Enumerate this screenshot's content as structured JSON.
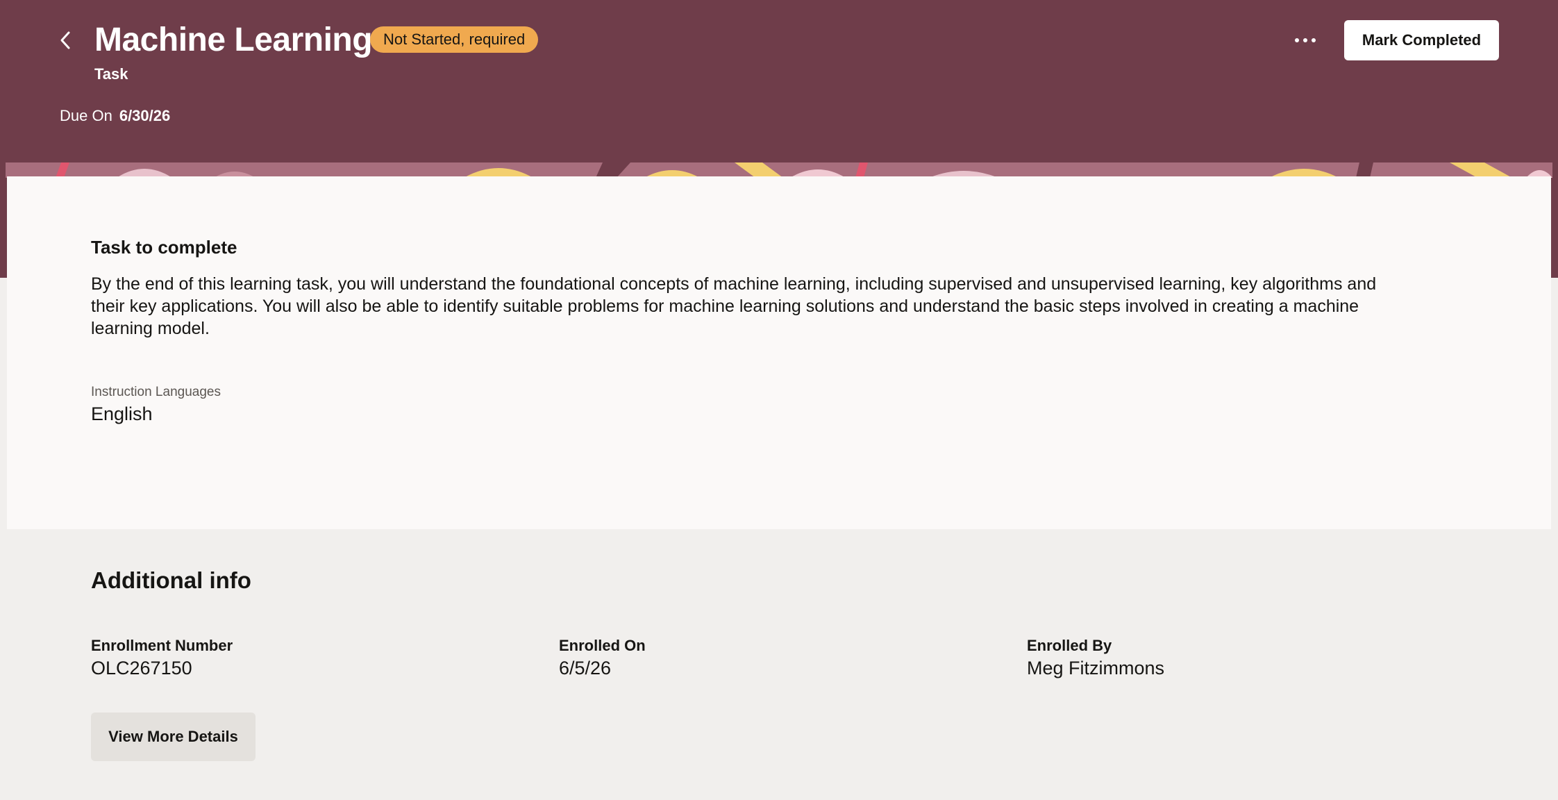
{
  "header": {
    "title": "Machine Learning",
    "status": "Not Started, required",
    "subtitle": "Task",
    "due_label": "Due On",
    "due_value": "6/30/26",
    "primary_action": "Mark Completed",
    "more_icon": "more-horizontal-icon",
    "back_icon": "chevron-left-icon"
  },
  "task": {
    "heading": "Task to complete",
    "description": "By the end of this learning task, you will understand the foundational concepts of machine learning, including supervised and unsupervised learning, key algorithms and their key applications. You will also be able to identify suitable problems for machine learning solutions and understand the basic steps involved in creating a machine learning model.",
    "languages_label": "Instruction Languages",
    "languages_value": "English"
  },
  "additional_info": {
    "heading": "Additional info",
    "fields": [
      {
        "label": "Enrollment Number",
        "value": "OLC267150"
      },
      {
        "label": "Enrolled On",
        "value": "6/5/26"
      },
      {
        "label": "Enrolled By",
        "value": "Meg Fitzimmons"
      }
    ],
    "button": "View More Details"
  },
  "colors": {
    "header_bg": "#6f3d4a",
    "badge_bg": "#f0a94f",
    "card_bg": "#fbf9f8",
    "page_bg": "#f1efed",
    "secondary_button_bg": "#e4e1dd"
  }
}
